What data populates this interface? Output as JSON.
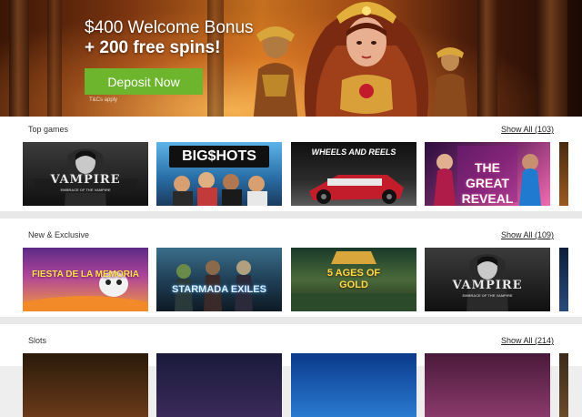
{
  "hero": {
    "headline_line1": "$400 Welcome Bonus",
    "headline_line2": "+ 200 free spins!",
    "cta_label": "Deposit Now",
    "terms": "T&Cs apply"
  },
  "sections": [
    {
      "title": "Top games",
      "show_all": "Show All (103)",
      "games": [
        {
          "name": "VAMPIRE",
          "subtitle": "EMBRACE OF THE VAMPIRE"
        },
        {
          "name": "BIG$HOTS"
        },
        {
          "name": "WHEELS AND REELS"
        },
        {
          "name": "THE GREAT REVEAL"
        }
      ]
    },
    {
      "title": "New & Exclusive",
      "show_all": "Show All (109)",
      "games": [
        {
          "name": "FIESTA DE LA MEMORIA"
        },
        {
          "name": "STARMADA EXILES"
        },
        {
          "name": "5 AGES OF GOLD"
        },
        {
          "name": "VAMPIRE",
          "subtitle": "EMBRACE OF THE VAMPIRE"
        }
      ]
    },
    {
      "title": "Slots",
      "show_all": "Show All (214)",
      "games": [
        {
          "name": ""
        },
        {
          "name": ""
        },
        {
          "name": ""
        },
        {
          "name": ""
        }
      ]
    }
  ],
  "colors": {
    "cta": "#6cb52d",
    "page_bg": "#eeeeee"
  }
}
